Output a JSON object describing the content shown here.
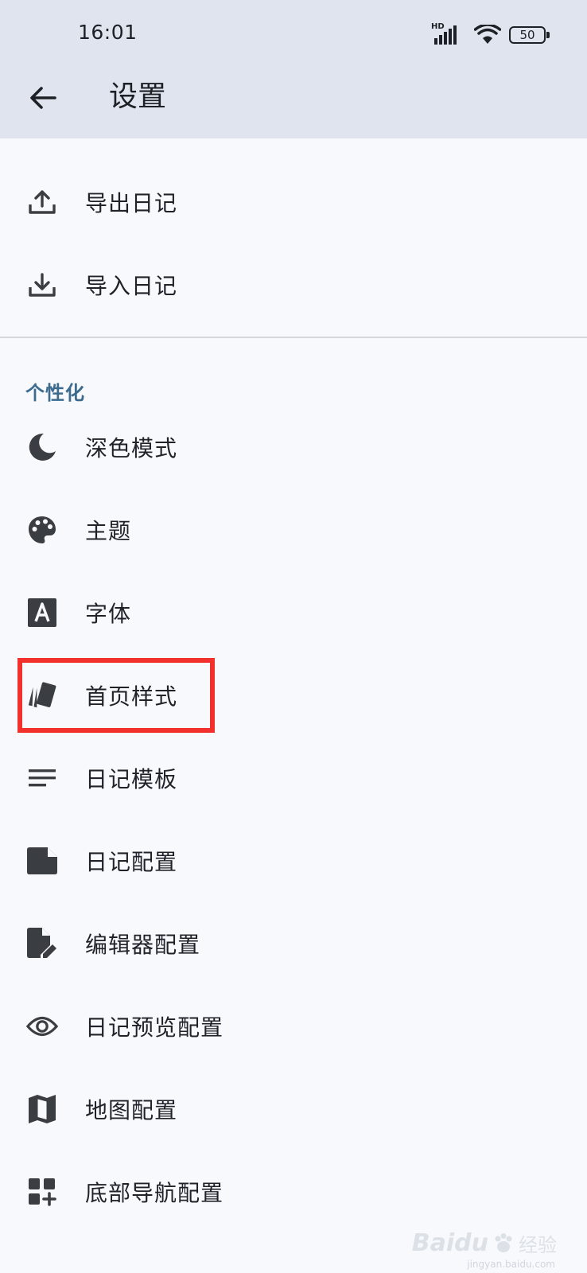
{
  "status_bar": {
    "time": "16:01",
    "network": "HD",
    "battery": "50"
  },
  "header": {
    "title": "设置"
  },
  "data_items": [
    {
      "label": "导出日记",
      "icon": "upload-icon"
    },
    {
      "label": "导入日记",
      "icon": "download-icon"
    }
  ],
  "personalization": {
    "header": "个性化",
    "items": [
      {
        "label": "深色模式",
        "icon": "moon-icon"
      },
      {
        "label": "主题",
        "icon": "palette-icon"
      },
      {
        "label": "字体",
        "icon": "font-icon"
      },
      {
        "label": "首页样式",
        "icon": "cards-icon"
      },
      {
        "label": "日记模板",
        "icon": "lines-icon"
      },
      {
        "label": "日记配置",
        "icon": "note-icon"
      },
      {
        "label": "编辑器配置",
        "icon": "edit-document-icon"
      },
      {
        "label": "日记预览配置",
        "icon": "eye-icon"
      },
      {
        "label": "地图配置",
        "icon": "map-icon"
      },
      {
        "label": "底部导航配置",
        "icon": "dashboard-add-icon"
      }
    ]
  },
  "watermark": {
    "brand": "Baidu",
    "sub": "经验",
    "url": "jingyan.baidu.com"
  },
  "colors": {
    "header_bg": "#dfe4ee",
    "page_bg": "#f7f9fd",
    "section_header": "#3d6b8e",
    "icon": "#3a3d42",
    "highlight": "#f2302c"
  }
}
